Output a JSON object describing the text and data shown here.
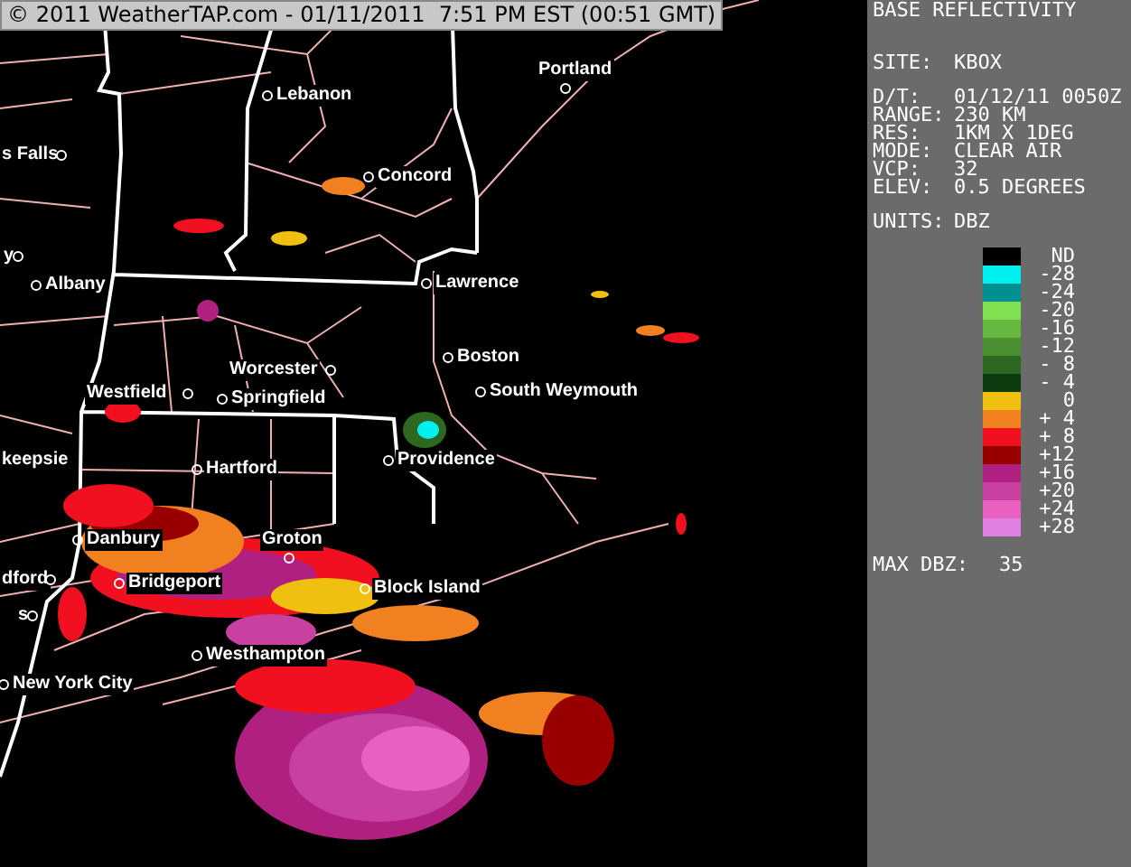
{
  "banner": "© 2011 WeatherTAP.com - 01/11/2011  7:51 PM EST (00:51 GMT)",
  "map": {
    "cities": [
      {
        "label": "Lebanon"
      },
      {
        "label": "Concord"
      },
      {
        "label": "s Falls"
      },
      {
        "label": "y"
      },
      {
        "label": "Albany"
      },
      {
        "label": "Portland"
      },
      {
        "label": "Lawrence"
      },
      {
        "label": "Boston"
      },
      {
        "label": "South Weymouth"
      },
      {
        "label": "Worcester"
      },
      {
        "label": "Westfield"
      },
      {
        "label": "Springfield"
      },
      {
        "label": "keepsie"
      },
      {
        "label": "Hartford"
      },
      {
        "label": "Providence"
      },
      {
        "label": "Danbury"
      },
      {
        "label": "Groton"
      },
      {
        "label": "dford"
      },
      {
        "label": "Bridgeport"
      },
      {
        "label": "s"
      },
      {
        "label": "Block Island"
      },
      {
        "label": "Westhampton"
      },
      {
        "label": "New York City"
      }
    ]
  },
  "panel": {
    "title": "BASE REFLECTIVITY",
    "site": {
      "label": "SITE:",
      "value": "KBOX"
    },
    "fields": [
      {
        "label": "D/T:",
        "value": "01/12/11 0050Z"
      },
      {
        "label": "RANGE:",
        "value": "230 KM"
      },
      {
        "label": "RES:",
        "value": "1KM X 1DEG"
      },
      {
        "label": "MODE:",
        "value": "CLEAR AIR"
      },
      {
        "label": "VCP:",
        "value": "32"
      },
      {
        "label": "ELEV:",
        "value": "0.5 DEGREES"
      }
    ],
    "units": {
      "label": "UNITS:",
      "value": "DBZ"
    },
    "legend": [
      {
        "label": "ND",
        "color": "#000000"
      },
      {
        "label": "-28",
        "color": "#00f0f0"
      },
      {
        "label": "-24",
        "color": "#009090"
      },
      {
        "label": "-20",
        "color": "#80e050"
      },
      {
        "label": "-16",
        "color": "#66b840"
      },
      {
        "label": "-12",
        "color": "#4a9030"
      },
      {
        "label": "- 8",
        "color": "#2c6820"
      },
      {
        "label": "- 4",
        "color": "#0c3c10"
      },
      {
        "label": "0",
        "color": "#f0c010"
      },
      {
        "label": "+ 4",
        "color": "#f08020"
      },
      {
        "label": "+ 8",
        "color": "#f01020"
      },
      {
        "label": "+12",
        "color": "#980000"
      },
      {
        "label": "+16",
        "color": "#b02080"
      },
      {
        "label": "+20",
        "color": "#c840a0"
      },
      {
        "label": "+24",
        "color": "#e860c0"
      },
      {
        "label": "+28",
        "color": "#e080e0"
      }
    ],
    "max": {
      "label": "MAX DBZ:",
      "value": "35"
    }
  }
}
